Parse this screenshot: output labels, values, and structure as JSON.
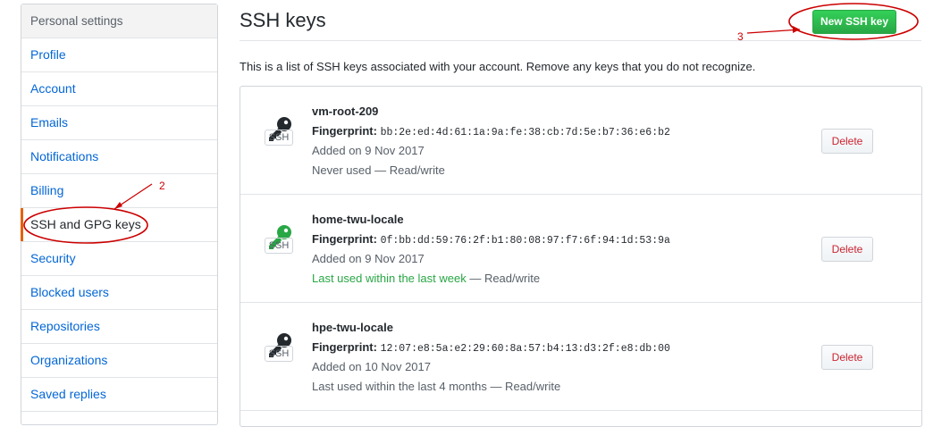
{
  "sidebar": {
    "header": "Personal settings",
    "items": [
      {
        "label": "Profile"
      },
      {
        "label": "Account"
      },
      {
        "label": "Emails"
      },
      {
        "label": "Notifications"
      },
      {
        "label": "Billing"
      },
      {
        "label": "SSH and GPG keys",
        "selected": true
      },
      {
        "label": "Security"
      },
      {
        "label": "Blocked users"
      },
      {
        "label": "Repositories"
      },
      {
        "label": "Organizations"
      },
      {
        "label": "Saved replies"
      }
    ]
  },
  "main": {
    "title": "SSH keys",
    "new_key_button": "New SSH key",
    "intro": "This is a list of SSH keys associated with your account. Remove any keys that you do not recognize.",
    "fingerprint_label": "Fingerprint:",
    "delete_label": "Delete",
    "badge": "SSH",
    "keys": [
      {
        "title": "vm-root-209",
        "fingerprint": "bb:2e:ed:4d:61:1a:9a:fe:38:cb:7d:5e:b7:36:e6:b2",
        "added": "Added on 9 Nov 2017",
        "usage_highlight": "",
        "usage_rest": "Never used — Read/write",
        "icon_color": "#24292e"
      },
      {
        "title": "home-twu-locale",
        "fingerprint": "0f:bb:dd:59:76:2f:b1:80:08:97:f7:6f:94:1d:53:9a",
        "added": "Added on 9 Nov 2017",
        "usage_highlight": "Last used within the last week",
        "usage_rest": " — Read/write",
        "icon_color": "#28a745"
      },
      {
        "title": "hpe-twu-locale",
        "fingerprint": "12:07:e8:5a:e2:29:60:8a:57:b4:13:d3:2f:e8:db:00",
        "added": "Added on 10 Nov 2017",
        "usage_highlight": "",
        "usage_rest": "Last used within the last 4 months — Read/write",
        "icon_color": "#24292e"
      }
    ]
  },
  "annotations": {
    "label_2": "2",
    "label_3": "3",
    "color": "#cc0000"
  }
}
